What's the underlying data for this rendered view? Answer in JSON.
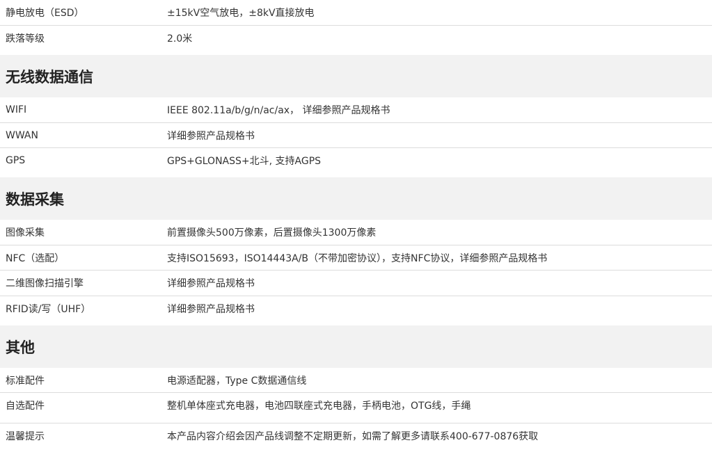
{
  "groups": [
    {
      "rows": [
        {
          "label": "静电放电（ESD）",
          "value": "±15kV空气放电，±8kV直接放电"
        },
        {
          "label": "跌落等级",
          "value": "2.0米"
        }
      ]
    },
    {
      "heading": "无线数据通信",
      "rows": [
        {
          "label": "WIFI",
          "value": "IEEE 802.11a/b/g/n/ac/ax， 详细参照产品规格书"
        },
        {
          "label": "WWAN",
          "value": "详细参照产品规格书"
        },
        {
          "label": "GPS",
          "value": "GPS+GLONASS+北斗, 支持AGPS"
        }
      ]
    },
    {
      "heading": "数据采集",
      "rows": [
        {
          "label": "图像采集",
          "value": "前置摄像头500万像素，后置摄像头1300万像素"
        },
        {
          "label": "NFC（选配）",
          "value": "支持ISO15693，ISO14443A/B（不带加密协议），支持NFC协议，详细参照产品规格书"
        },
        {
          "label": "二维图像扫描引擎",
          "value": "详细参照产品规格书"
        },
        {
          "label": "RFID读/写（UHF）",
          "value": "详细参照产品规格书"
        }
      ]
    },
    {
      "heading": "其他",
      "rows": [
        {
          "label": "标准配件",
          "value": "电源适配器，Type C数据通信线"
        },
        {
          "label": "自选配件",
          "value": "整机单体座式充电器，电池四联座式充电器，手柄电池，OTG线，手绳"
        },
        {
          "label": "温馨提示",
          "value": "本产品内容介绍会因产品线调整不定期更新，如需了解更多请联系400-677-0876获取"
        }
      ]
    }
  ]
}
